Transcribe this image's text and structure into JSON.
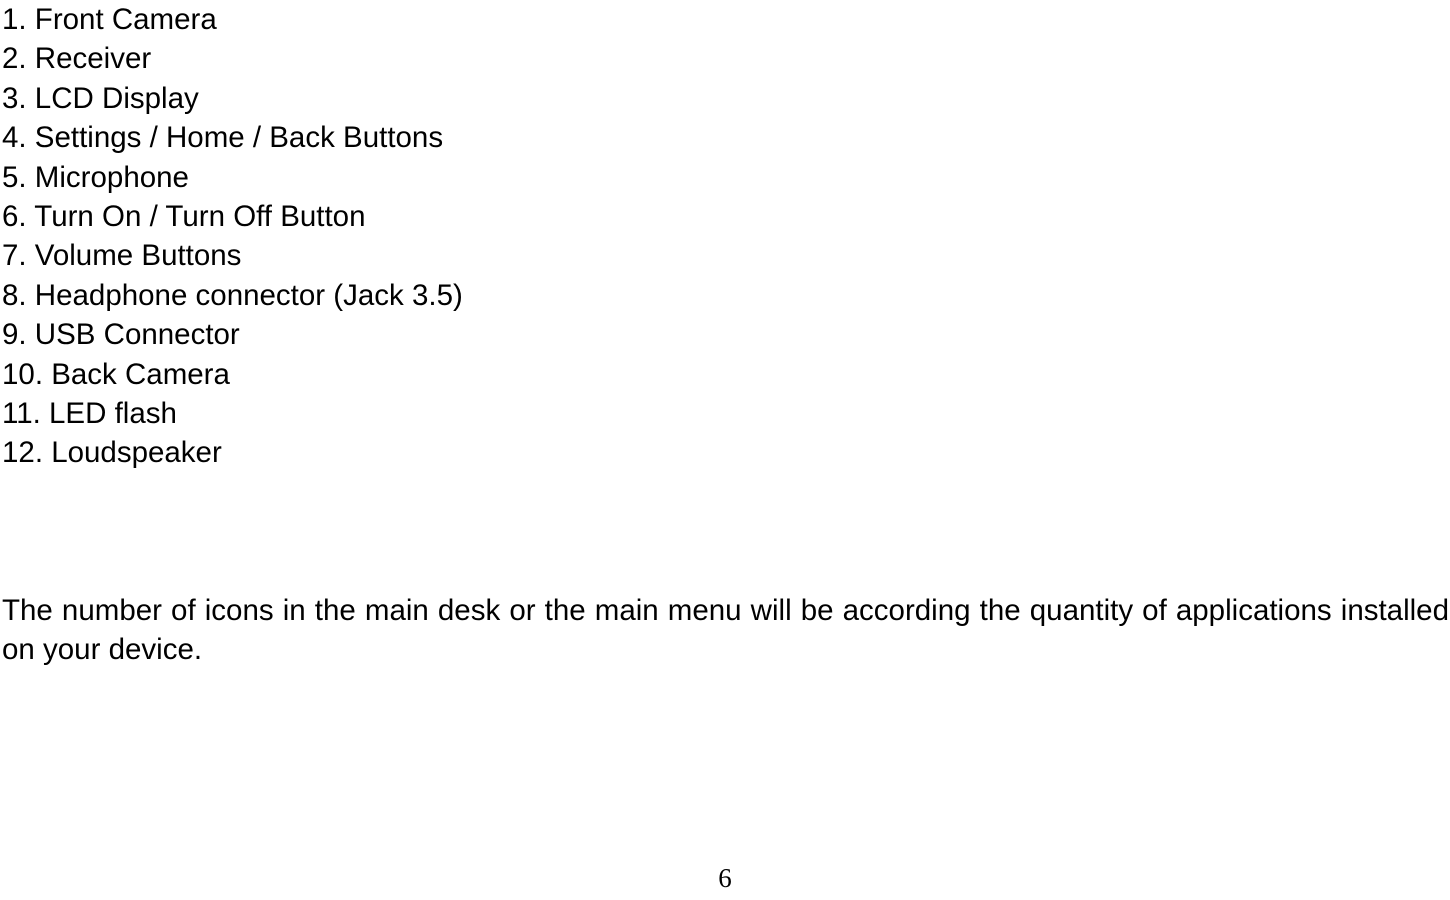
{
  "document": {
    "parts_list": [
      "1. Front Camera",
      "2. Receiver",
      "3. LCD Display",
      "4. Settings / Home / Back Buttons",
      "5. Microphone",
      "6. Turn On / Turn Off Button",
      "7. Volume Buttons",
      "8. Headphone connector (Jack 3.5)",
      "9. USB Connector",
      "10. Back Camera",
      "11. LED flash",
      "12. Loudspeaker"
    ],
    "paragraph": "The number of icons in the main desk or the main menu will be according the quantity of applications installed on your device.",
    "page_number": "6"
  },
  "colors": {
    "text": "#000000",
    "background": "#ffffff"
  }
}
